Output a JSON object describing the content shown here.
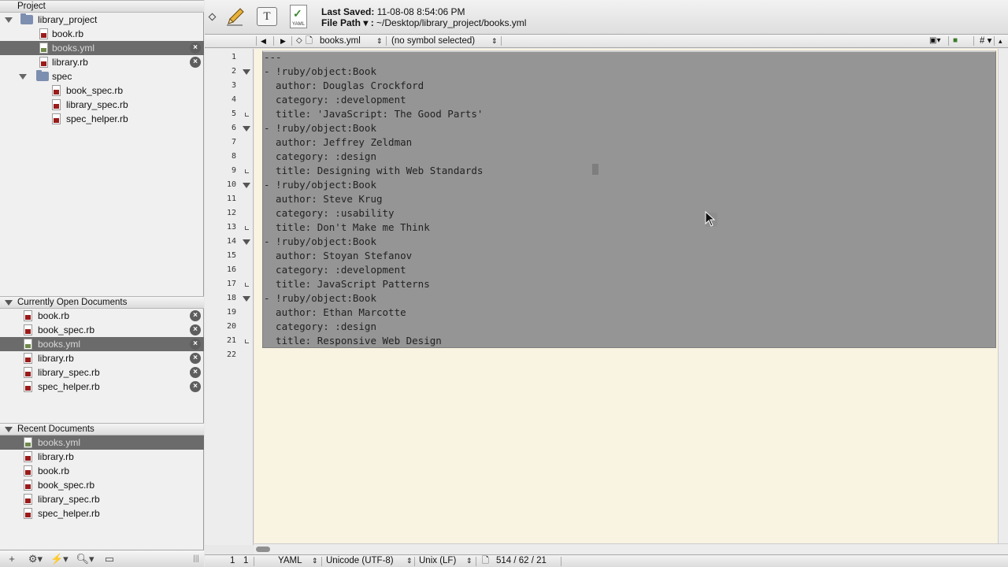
{
  "sidebar": {
    "project_header": "Project",
    "project_tree": [
      {
        "label": "library_project",
        "kind": "folder"
      },
      {
        "label": "book.rb",
        "kind": "rb"
      },
      {
        "label": "books.yml",
        "kind": "yml"
      },
      {
        "label": "library.rb",
        "kind": "rb"
      },
      {
        "label": "spec",
        "kind": "folder"
      },
      {
        "label": "book_spec.rb",
        "kind": "rb"
      },
      {
        "label": "library_spec.rb",
        "kind": "rb"
      },
      {
        "label": "spec_helper.rb",
        "kind": "rb"
      }
    ],
    "open_docs_header": "Currently Open Documents",
    "open_docs": [
      "book.rb",
      "book_spec.rb",
      "books.yml",
      "library.rb",
      "library_spec.rb",
      "spec_helper.rb"
    ],
    "recent_header": "Recent Documents",
    "recent_docs": [
      "books.yml",
      "library.rb",
      "book.rb",
      "book_spec.rb",
      "library_spec.rb",
      "spec_helper.rb"
    ],
    "selected_file": "books.yml"
  },
  "toolbar": {
    "last_saved_label": "Last Saved:",
    "last_saved_value": "11-08-08 8:54:06 PM",
    "file_path_label": "File Path ▾ :",
    "file_path_value": "~/Desktop/library_project/books.yml",
    "yaml_icon_label": "YAML",
    "text_icon_label": "T"
  },
  "navbar": {
    "back": "◀",
    "forward": "▶",
    "file_name": "books.yml",
    "symbol": "(no symbol selected)",
    "hash": "#"
  },
  "editor": {
    "line_numbers": [
      "1",
      "2",
      "3",
      "4",
      "5",
      "6",
      "7",
      "8",
      "9",
      "10",
      "11",
      "12",
      "13",
      "14",
      "15",
      "16",
      "17",
      "18",
      "19",
      "20",
      "21",
      "22"
    ],
    "lines": [
      "---",
      "- !ruby/object:Book",
      "  author: Douglas Crockford",
      "  category: :development",
      "  title: 'JavaScript: The Good Parts'",
      "- !ruby/object:Book",
      "  author: Jeffrey Zeldman",
      "  category: :design",
      "  title: Designing with Web Standards",
      "- !ruby/object:Book",
      "  author: Steve Krug",
      "  category: :usability",
      "  title: Don't Make me Think",
      "- !ruby/object:Book",
      "  author: Stoyan Stefanov",
      "  category: :development",
      "  title: JavaScript Patterns",
      "- !ruby/object:Book",
      "  author: Ethan Marcotte",
      "  category: :design",
      "  title: Responsive Web Design",
      ""
    ]
  },
  "status": {
    "line": "1",
    "col": "1",
    "syntax": "YAML",
    "encoding": "Unicode (UTF-8)",
    "line_endings": "Unix (LF)",
    "counts": "514 / 62 / 21"
  },
  "colors": {
    "editor_background": "#f9f3e1",
    "selection": "#959595",
    "selected_row": "#6b6b6b",
    "rb_icon": "#9b1b1b"
  }
}
